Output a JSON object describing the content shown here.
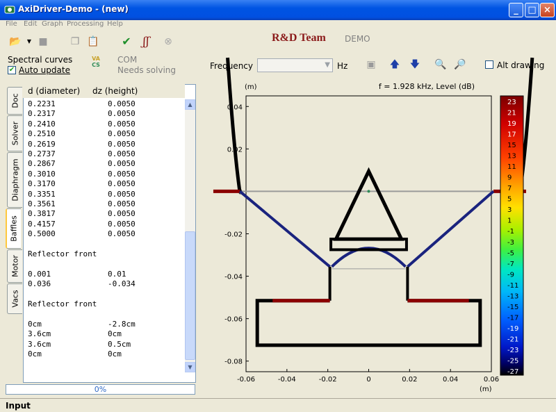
{
  "window": {
    "title": "AxiDriver-Demo - (new)"
  },
  "menu": [
    "File",
    "Edit",
    "Graph",
    "Processing",
    "Help"
  ],
  "toolbar": {
    "brand": "R&D Team",
    "demo": "DEMO"
  },
  "left_controls": {
    "spectral_label": "Spectral curves",
    "auto_update_label": "Auto update",
    "auto_update_checked": true,
    "com_label": "COM",
    "needs_solving": "Needs solving"
  },
  "frequency": {
    "label": "Frequency",
    "value": "",
    "unit": "Hz"
  },
  "alt_drawing": {
    "label": "Alt drawing",
    "checked": false
  },
  "tabs": [
    "Doc",
    "Solver",
    "Diaphragm",
    "Baffles",
    "Motor",
    "Vacs"
  ],
  "active_tab": "Baffles",
  "table": {
    "col1": "d (diameter)",
    "col2": "dz (height)",
    "rows": [
      [
        "0.2231",
        "0.0050"
      ],
      [
        "0.2317",
        "0.0050"
      ],
      [
        "0.2410",
        "0.0050"
      ],
      [
        "0.2510",
        "0.0050"
      ],
      [
        "0.2619",
        "0.0050"
      ],
      [
        "0.2737",
        "0.0050"
      ],
      [
        "0.2867",
        "0.0050"
      ],
      [
        "0.3010",
        "0.0050"
      ],
      [
        "0.3170",
        "0.0050"
      ],
      [
        "0.3351",
        "0.0050"
      ],
      [
        "0.3561",
        "0.0050"
      ],
      [
        "0.3817",
        "0.0050"
      ],
      [
        "0.4157",
        "0.0050"
      ],
      [
        "0.5000",
        "0.0050"
      ]
    ],
    "section1_title": "Reflector front",
    "section1_rows": [
      [
        "0.001",
        "0.01"
      ],
      [
        "0.036",
        "-0.034"
      ]
    ],
    "section2_title": "Reflector front",
    "section2_rows": [
      [
        "0cm",
        "-2.8cm"
      ],
      [
        "3.6cm",
        "0cm"
      ],
      [
        "3.6cm",
        "0.5cm"
      ],
      [
        "0cm",
        "0cm"
      ]
    ]
  },
  "progress": "0%",
  "status": "Input",
  "chart_data": {
    "type": "line",
    "title": "f = 1.928 kHz, Level  (dB)",
    "ylabel": "(m)",
    "xlabel": "(m)",
    "xlim": [
      -0.06,
      0.06
    ],
    "ylim": [
      -0.085,
      0.045
    ],
    "xticks": [
      "-0.06",
      "-0.04",
      "-0.02",
      "0",
      "0.02",
      "0.04",
      "0.06"
    ],
    "yticks": [
      "0.04",
      "0.02",
      "0",
      "-0.02",
      "-0.04",
      "-0.06",
      "-0.08"
    ],
    "colorbar_ticks": [
      "23",
      "21",
      "19",
      "17",
      "15",
      "13",
      "11",
      "9",
      "7",
      "5",
      "3",
      "1",
      "-1",
      "-3",
      "-5",
      "-7",
      "-9",
      "-11",
      "-13",
      "-15",
      "-17",
      "-19",
      "-21",
      "-23",
      "-25",
      "-27"
    ]
  }
}
